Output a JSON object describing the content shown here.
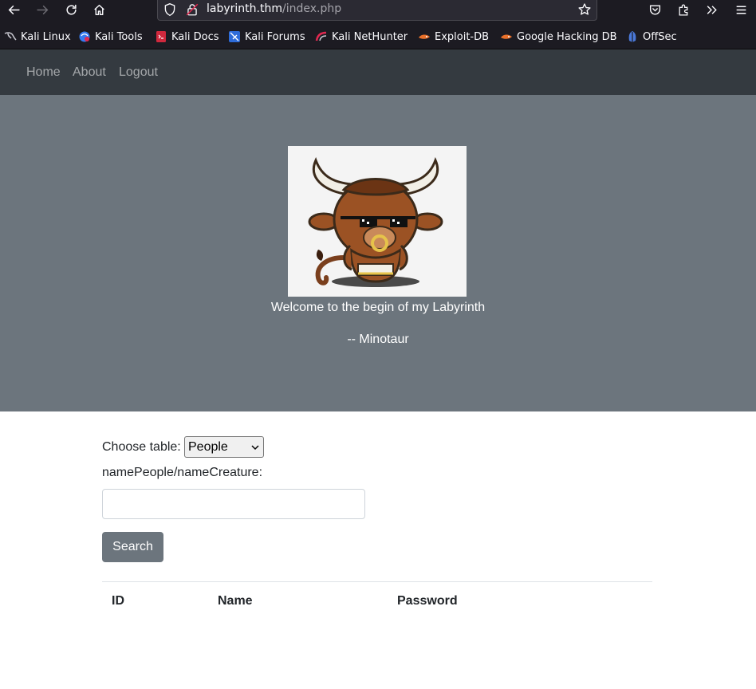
{
  "browser": {
    "url_host": "labyrinth.thm",
    "url_path": "/index.php",
    "bookmarks": [
      {
        "label": "Kali Linux",
        "icon": "kali-dragon-icon"
      },
      {
        "label": "Kali Tools",
        "icon": "kali-tools-icon"
      },
      {
        "label": "Kali Docs",
        "icon": "kali-docs-icon"
      },
      {
        "label": "Kali Forums",
        "icon": "kali-forums-icon"
      },
      {
        "label": "Kali NetHunter",
        "icon": "nethunter-icon"
      },
      {
        "label": "Exploit-DB",
        "icon": "exploit-db-icon"
      },
      {
        "label": "Google Hacking DB",
        "icon": "ghdb-icon"
      },
      {
        "label": "OffSec",
        "icon": "offsec-icon"
      }
    ]
  },
  "navbar": {
    "links": [
      "Home",
      "About",
      "Logout"
    ]
  },
  "hero": {
    "image": "minotaur-with-sunglasses",
    "welcome": "Welcome to the begin of my Labyrinth",
    "signature": "-- Minotaur"
  },
  "form": {
    "table_label": "Choose table:",
    "table_selected": "People",
    "name_label": "namePeople/nameCreature:",
    "name_value": "",
    "search_button": "Search"
  },
  "table": {
    "headers": [
      "ID",
      "Name",
      "Password"
    ]
  },
  "colors": {
    "navbar": "#343a40",
    "hero": "#6c757d",
    "button": "#6c757d"
  }
}
